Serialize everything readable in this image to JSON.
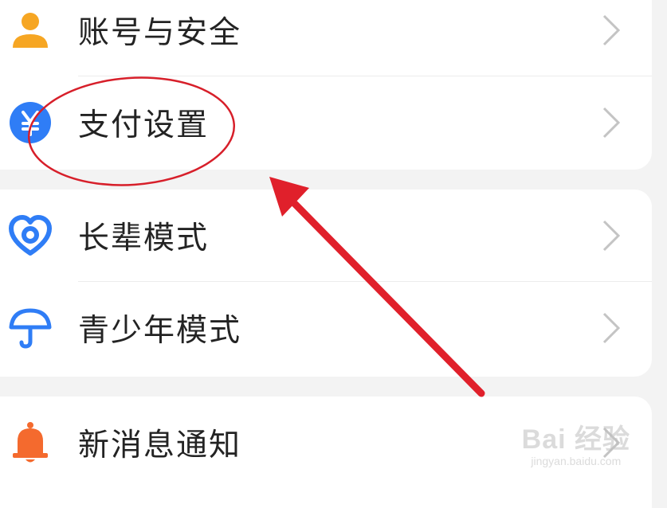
{
  "menu": {
    "groups": [
      {
        "items": [
          {
            "label": "账号与安全",
            "icon": "user-icon",
            "icon_color": "#f6a623"
          },
          {
            "label": "支付设置",
            "icon": "yen-coin-icon",
            "icon_color": "#2f7df6"
          }
        ]
      },
      {
        "items": [
          {
            "label": "长辈模式",
            "icon": "heart-ring-icon",
            "icon_color": "#2f7df6"
          },
          {
            "label": "青少年模式",
            "icon": "umbrella-icon",
            "icon_color": "#2f7df6"
          }
        ]
      },
      {
        "items": [
          {
            "label": "新消息通知",
            "icon": "bell-icon",
            "icon_color": "#f46a2e"
          }
        ]
      }
    ]
  },
  "annotation": {
    "highlight_color": "#d71f2a",
    "highlight_target": "支付设置"
  },
  "watermark": {
    "logo": "Bai 经验",
    "url": "jingyan.baidu.com"
  },
  "colors": {
    "background": "#f3f3f3",
    "card": "#ffffff",
    "text": "#232323",
    "chevron": "#c4c4c4"
  }
}
